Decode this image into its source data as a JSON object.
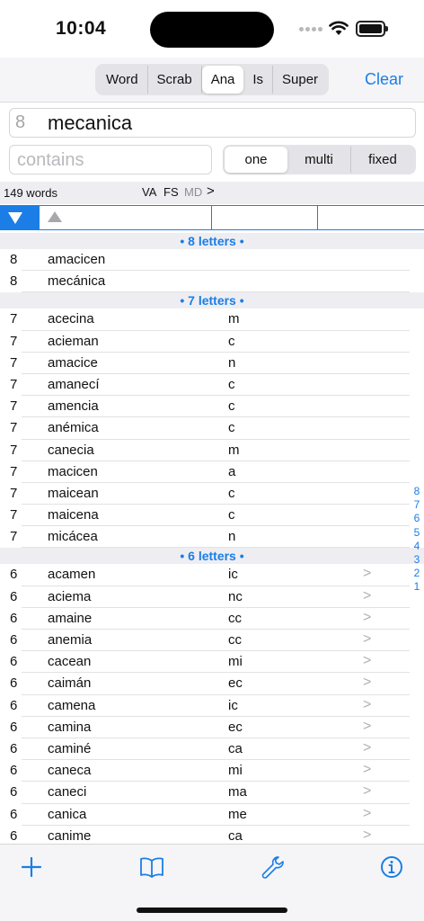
{
  "status": {
    "time": "10:04"
  },
  "nav": {
    "modes": [
      "Word",
      "Scrab",
      "Ana",
      "Is",
      "Super"
    ],
    "active_mode": "Ana",
    "clear_label": "Clear"
  },
  "search": {
    "length": "8",
    "word": "mecanica",
    "contains_placeholder": "contains",
    "match_modes": [
      "one",
      "multi",
      "fixed"
    ],
    "active_match": "one"
  },
  "info": {
    "count": "149 words",
    "flags": {
      "va": "VA",
      "fs": "FS",
      "md": "MD"
    },
    "chevron": ">"
  },
  "sections": [
    {
      "title": "• 8 letters •",
      "rows": [
        {
          "n": "8",
          "word": "amacicen",
          "missing": "",
          "arrow": ""
        },
        {
          "n": "8",
          "word": "mecánica",
          "missing": "",
          "arrow": ""
        }
      ]
    },
    {
      "title": "• 7 letters •",
      "rows": [
        {
          "n": "7",
          "word": "acecina",
          "missing": "m",
          "arrow": ""
        },
        {
          "n": "7",
          "word": "acieman",
          "missing": "c",
          "arrow": ""
        },
        {
          "n": "7",
          "word": "amacice",
          "missing": "n",
          "arrow": ""
        },
        {
          "n": "7",
          "word": "amanecí",
          "missing": "c",
          "arrow": ""
        },
        {
          "n": "7",
          "word": "amencia",
          "missing": "c",
          "arrow": ""
        },
        {
          "n": "7",
          "word": "anémica",
          "missing": "c",
          "arrow": ""
        },
        {
          "n": "7",
          "word": "canecia",
          "missing": "m",
          "arrow": ""
        },
        {
          "n": "7",
          "word": "macicen",
          "missing": "a",
          "arrow": ""
        },
        {
          "n": "7",
          "word": "maicean",
          "missing": "c",
          "arrow": ""
        },
        {
          "n": "7",
          "word": "maicena",
          "missing": "c",
          "arrow": ""
        },
        {
          "n": "7",
          "word": "micácea",
          "missing": "n",
          "arrow": ""
        }
      ]
    },
    {
      "title": "• 6 letters •",
      "rows": [
        {
          "n": "6",
          "word": "acamen",
          "missing": "ic",
          "arrow": ">"
        },
        {
          "n": "6",
          "word": "aciema",
          "missing": "nc",
          "arrow": ">"
        },
        {
          "n": "6",
          "word": "amaine",
          "missing": "cc",
          "arrow": ">"
        },
        {
          "n": "6",
          "word": "anemia",
          "missing": "cc",
          "arrow": ">"
        },
        {
          "n": "6",
          "word": "cacean",
          "missing": "mi",
          "arrow": ">"
        },
        {
          "n": "6",
          "word": "caimán",
          "missing": "ec",
          "arrow": ">"
        },
        {
          "n": "6",
          "word": "camena",
          "missing": "ic",
          "arrow": ">"
        },
        {
          "n": "6",
          "word": "camina",
          "missing": "ec",
          "arrow": ">"
        },
        {
          "n": "6",
          "word": "caminé",
          "missing": "ca",
          "arrow": ">"
        },
        {
          "n": "6",
          "word": "caneca",
          "missing": "mi",
          "arrow": ">"
        },
        {
          "n": "6",
          "word": "caneci",
          "missing": "ma",
          "arrow": ">"
        },
        {
          "n": "6",
          "word": "canica",
          "missing": "me",
          "arrow": ">"
        },
        {
          "n": "6",
          "word": "canime",
          "missing": "ca",
          "arrow": ">"
        }
      ]
    }
  ],
  "index": [
    "8",
    "7",
    "6",
    "5",
    "4",
    "3",
    "2",
    "1"
  ],
  "colors": {
    "accent": "#1a7ee6",
    "muted": "#a5a5a5"
  }
}
